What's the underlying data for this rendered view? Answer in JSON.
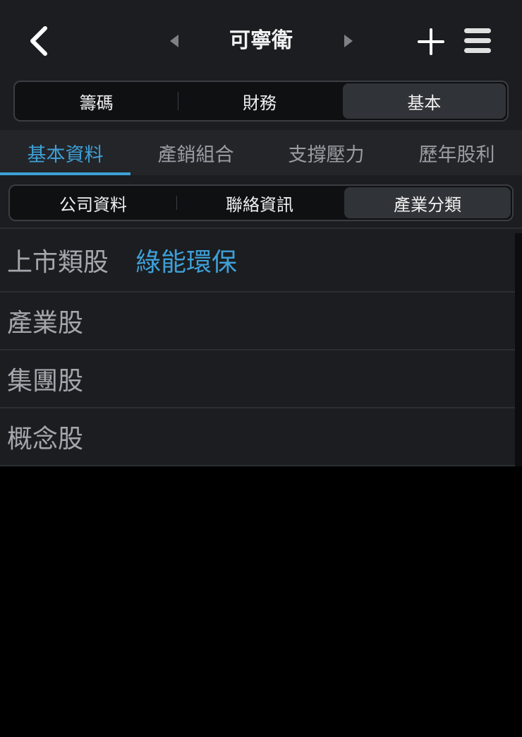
{
  "header": {
    "title": "可寧衛"
  },
  "main_tabs": [
    "籌碼",
    "財務",
    "基本"
  ],
  "main_tab_active": 2,
  "sub_tabs": [
    "基本資料",
    "產銷組合",
    "支撐壓力",
    "歷年股利"
  ],
  "sub_tab_active": 0,
  "info_tabs": [
    "公司資料",
    "聯絡資訊",
    "產業分類"
  ],
  "info_tab_active": 2,
  "rows": [
    {
      "label": "上市類股",
      "value": "綠能環保"
    },
    {
      "label": "產業股",
      "value": ""
    },
    {
      "label": "集團股",
      "value": ""
    },
    {
      "label": "概念股",
      "value": ""
    }
  ],
  "colors": {
    "accent": "#3ea0d8",
    "header_bg": "#1b1d20",
    "page_bg": "#000000"
  },
  "icons": {
    "back": "chevron-left-icon",
    "prev": "triangle-left-icon",
    "next": "triangle-right-icon",
    "add": "plus-icon",
    "menu": "hamburger-menu-icon"
  }
}
